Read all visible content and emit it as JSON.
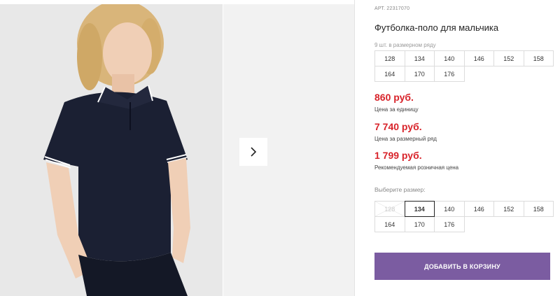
{
  "product": {
    "article_label": "АРТ. 22317070",
    "title": "Футболка-поло для мальчика",
    "pack_note": "9 шт. в размерном ряду",
    "pack_sizes": [
      "128",
      "134",
      "140",
      "146",
      "152",
      "158",
      "164",
      "170",
      "176"
    ],
    "prices": [
      {
        "value": "860 руб.",
        "label": "Цена за единицу"
      },
      {
        "value": "7 740 руб.",
        "label": "Цена за размерный ряд"
      },
      {
        "value": "1 799 руб.",
        "label": "Рекомендуемая розничная цена"
      }
    ],
    "choose_size_label": "Выберите размер:",
    "size_options": [
      {
        "label": "128",
        "state": "unavailable"
      },
      {
        "label": "134",
        "state": "selected"
      },
      {
        "label": "140",
        "state": "available"
      },
      {
        "label": "146",
        "state": "available"
      },
      {
        "label": "152",
        "state": "available"
      },
      {
        "label": "158",
        "state": "available"
      },
      {
        "label": "164",
        "state": "available"
      },
      {
        "label": "170",
        "state": "available"
      },
      {
        "label": "176",
        "state": "available"
      }
    ],
    "add_to_cart_label": "ДОБАВИТЬ В КОРЗИНУ"
  },
  "gallery": {
    "next_icon": "chevron-right-icon"
  },
  "colors": {
    "price_red": "#d8232a",
    "cart_button_purple": "#7b5ca1",
    "shirt_navy": "#1b2033"
  }
}
